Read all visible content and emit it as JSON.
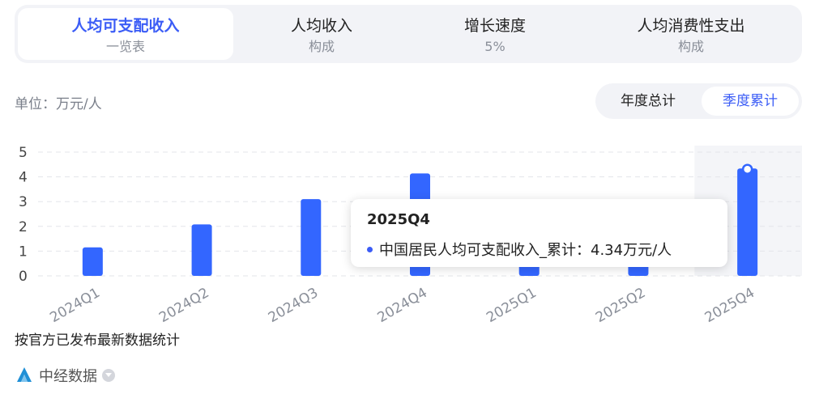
{
  "tabs": [
    {
      "label": "人均可支配收入",
      "sub": "一览表"
    },
    {
      "label": "人均收入",
      "sub": "构成"
    },
    {
      "label": "增长速度",
      "sub": "5%"
    },
    {
      "label": "人均消费性支出",
      "sub": "构成"
    }
  ],
  "unit_label": "单位：万元/人",
  "segmented": {
    "options": [
      "年度总计",
      "季度累计"
    ],
    "selected": "季度累计"
  },
  "colors": {
    "accent": "#3b5cf6",
    "bar": "#3366ff",
    "grid": "#e3e5ea"
  },
  "chart_data": {
    "type": "bar",
    "categories": [
      "2024Q1",
      "2024Q2",
      "2024Q3",
      "2024Q4",
      "2025Q1",
      "2025Q2",
      "2025Q4"
    ],
    "series": [
      {
        "name": "中国居民人均可支配收入_累计",
        "values": [
          1.15,
          2.08,
          3.1,
          4.14,
          1.22,
          2.2,
          4.34
        ]
      }
    ],
    "yticks": [
      0,
      1,
      2,
      3,
      4,
      5
    ],
    "ylim": [
      0,
      5
    ],
    "grid": true,
    "highlight_index": 6
  },
  "tooltip": {
    "title": "2025Q4",
    "row_text": "中国居民人均可支配收入_累计：4.34万元/人"
  },
  "footer": {
    "note": "按官方已发布最新数据统计",
    "brand": "中经数据"
  }
}
